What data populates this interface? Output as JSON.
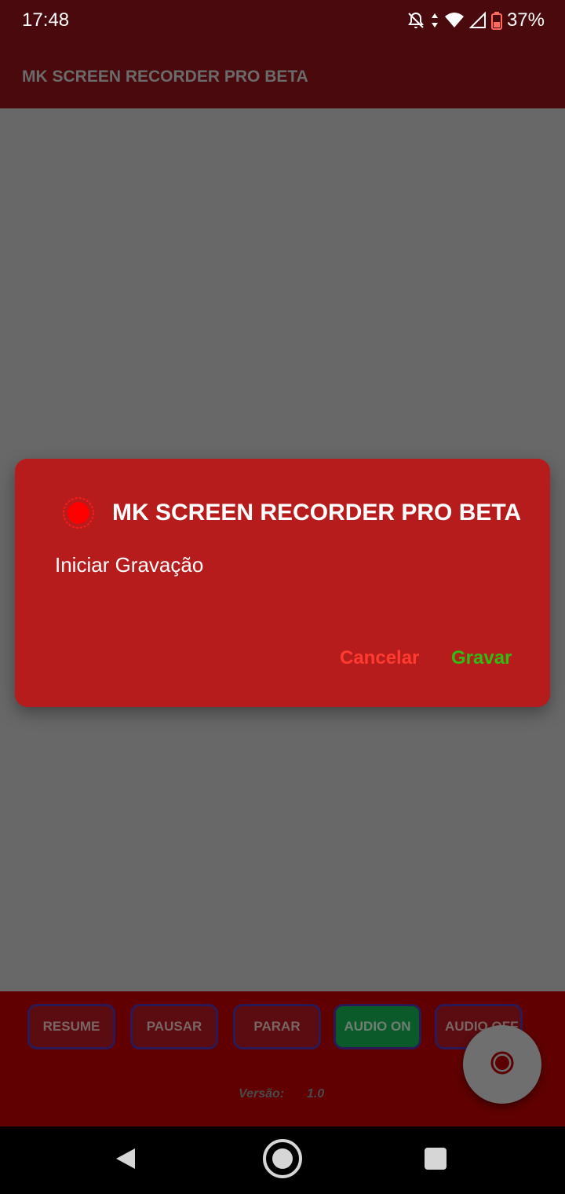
{
  "status_bar": {
    "time": "17:48",
    "battery_percent": "37%",
    "icons": [
      "notifications-off-icon",
      "data-arrows-icon",
      "wifi-icon",
      "signal-icon",
      "battery-icon"
    ]
  },
  "app_bar": {
    "title": "MK SCREEN RECORDER PRO BETA"
  },
  "dialog": {
    "icon": "record-icon",
    "title": "MK SCREEN RECORDER PRO BETA",
    "message": "Iniciar Gravação",
    "cancel_label": "Cancelar",
    "confirm_label": "Gravar"
  },
  "controls": {
    "resume": "RESUME",
    "pause": "PAUSAR",
    "stop": "PARAR",
    "audio_on": "AUDIO ON",
    "audio_off": "AUDIO OFF"
  },
  "version": {
    "label": "Versão:",
    "value": "1.0"
  },
  "fab": {
    "icon": "record-icon"
  },
  "nav_bar": {
    "icons": [
      "back-icon",
      "home-icon",
      "recents-icon"
    ]
  },
  "colors": {
    "dialog_bg": "#b71c1c",
    "app_bar_bg": "#4a0a0d",
    "cancel": "#ff3b30",
    "confirm": "#2ebd14",
    "audio_on_bg": "#0b5a2a"
  }
}
